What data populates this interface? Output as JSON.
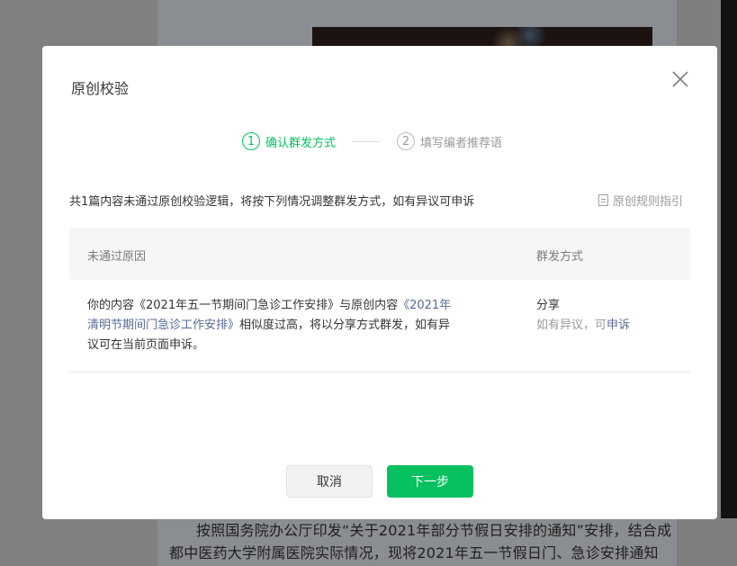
{
  "background": {
    "article_line1": "按照国务院办公厅印发“关于2021年部分节假日安排的通知”安排，结合成",
    "article_line2": "都中医药大学附属医院实际情况，现将2021年五一节假日门、急诊安排通知"
  },
  "modal": {
    "title": "原创校验",
    "steps": [
      {
        "number": "1",
        "label": "确认群发方式",
        "active": true
      },
      {
        "number": "2",
        "label": "填写编者推荐语",
        "active": false
      }
    ],
    "description": "共1篇内容未通过原创校验逻辑，将按下列情况调整群发方式，如有异议可申诉",
    "rule_link": "原创规则指引",
    "table": {
      "headers": {
        "reason": "未通过原因",
        "method": "群发方式"
      },
      "rows": [
        {
          "reason_prefix": "你的内容《2021年五一节期间门急诊工作安排》与原创内容",
          "reason_link": "《2021年清明节期间门急诊工作安排》",
          "reason_suffix": "相似度过高，将以分享方式群发，如有异议可在当前页面申诉。",
          "method": "分享",
          "hint_prefix": "如有异议，可",
          "hint_link": "申诉"
        }
      ]
    },
    "buttons": {
      "cancel": "取消",
      "next": "下一步"
    }
  },
  "colors": {
    "accent": "#07c160",
    "link": "#576b95",
    "overlay": "#7f7f7f"
  }
}
